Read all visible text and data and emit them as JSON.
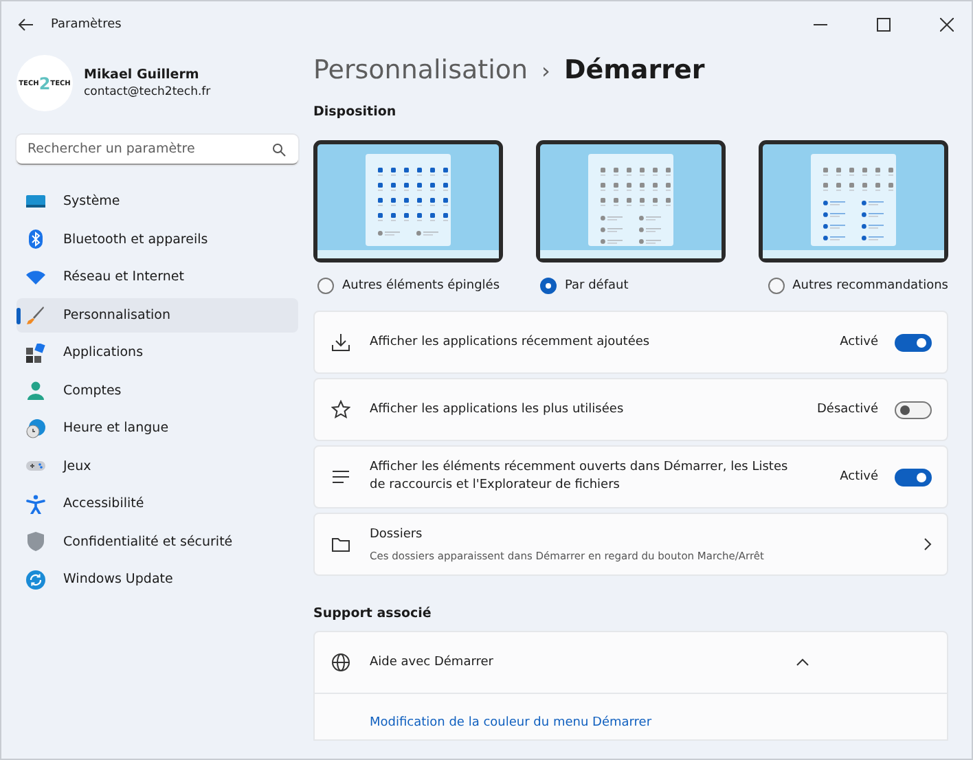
{
  "window": {
    "title": "Paramètres"
  },
  "profile": {
    "name": "Mikael Guillerm",
    "email": "contact@tech2tech.fr",
    "avatar_text": "TECH",
    "avatar_number": "2",
    "avatar_text2": "TECH"
  },
  "search": {
    "placeholder": "Rechercher un paramètre"
  },
  "sidebar": {
    "items": [
      {
        "label": "Système",
        "selected": false
      },
      {
        "label": "Bluetooth et appareils",
        "selected": false
      },
      {
        "label": "Réseau et Internet",
        "selected": false
      },
      {
        "label": "Personnalisation",
        "selected": true
      },
      {
        "label": "Applications",
        "selected": false
      },
      {
        "label": "Comptes",
        "selected": false
      },
      {
        "label": "Heure et langue",
        "selected": false
      },
      {
        "label": "Jeux",
        "selected": false
      },
      {
        "label": "Accessibilité",
        "selected": false
      },
      {
        "label": "Confidentialité et sécurité",
        "selected": false
      },
      {
        "label": "Windows Update",
        "selected": false
      }
    ]
  },
  "breadcrumb": {
    "parent": "Personnalisation",
    "separator": "›",
    "current": "Démarrer"
  },
  "layout_section": {
    "title": "Disposition",
    "options": [
      {
        "kind": "more_pins",
        "label": "Autres éléments épinglés",
        "selected": false
      },
      {
        "kind": "default",
        "label": "Par défaut",
        "selected": true
      },
      {
        "kind": "more_recs",
        "label": "Autres recommandations",
        "selected": false
      }
    ]
  },
  "settings": [
    {
      "kind": "toggle",
      "label": "Afficher les applications récemment ajoutées",
      "status": "Activé",
      "on": true
    },
    {
      "kind": "toggle",
      "label": "Afficher les applications les plus utilisées",
      "status": "Désactivé",
      "on": false
    },
    {
      "kind": "toggle",
      "label": "Afficher les éléments récemment ouverts dans Démarrer, les Listes de raccourcis et l'Explorateur de fichiers",
      "status": "Activé",
      "on": true
    },
    {
      "kind": "link",
      "label": "Dossiers",
      "description": "Ces dossiers apparaissent dans Démarrer en regard du bouton Marche/Arrêt"
    }
  ],
  "support": {
    "title": "Support associé",
    "help": {
      "label": "Aide avec Démarrer",
      "expanded": true
    },
    "links": [
      "Modification de la couleur du menu Démarrer"
    ]
  }
}
